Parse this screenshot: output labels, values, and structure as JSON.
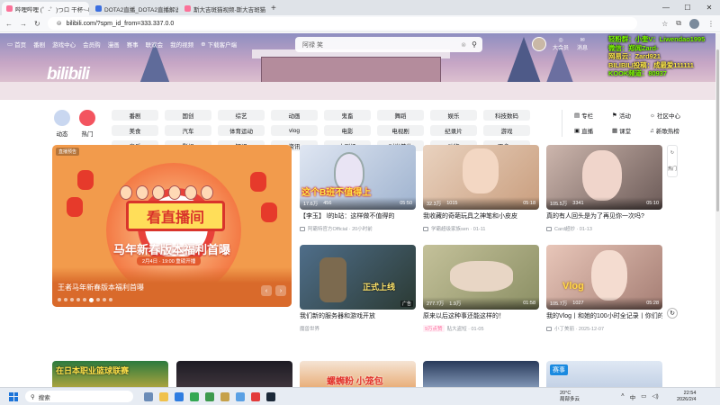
{
  "browser": {
    "tabs": [
      {
        "title": "哔哩哔哩 (゜-゜)つロ 干杯~-bi",
        "active": true
      },
      {
        "title": "DOTA2直播_DOTA2直播解说",
        "active": false
      },
      {
        "title": "斯大吉斑猫视频-斯大吉斑猫",
        "active": false
      }
    ],
    "new_tab": "+",
    "controls": {
      "min": "—",
      "max": "☐",
      "close": "✕"
    },
    "url": "bilibili.com/?spm_id_from=333.337.0.0"
  },
  "header": {
    "nav": [
      "首页",
      "番剧",
      "游戏中心",
      "会员购",
      "漫画",
      "赛事",
      "联欢会",
      "我的视频",
      "下载客户端"
    ],
    "logo": "bilibili",
    "search_placeholder": "阿禄 笑",
    "right_nav": [
      "大会员",
      "消息"
    ]
  },
  "overlay": {
    "line1": "轻粉群：小奎V：Liwendao1995",
    "line2": "微信：郑闻Zard-",
    "line3": "网易云：Zard921",
    "line4": "BILIBILI投稿：成最爱111111",
    "line5": "KOOK频道：80937"
  },
  "categories": {
    "dynamic": "动态",
    "hot": "热门",
    "chips": [
      "番剧",
      "国创",
      "综艺",
      "动画",
      "鬼畜",
      "舞蹈",
      "娱乐",
      "科技数码",
      "美食",
      "汽车",
      "体育运动",
      "vlog",
      "电影",
      "电视剧",
      "纪录片",
      "游戏",
      "音乐",
      "影视",
      "知识",
      "资讯",
      "小剧场",
      "时尚美妆",
      "动物",
      "更多 ⌄"
    ],
    "links": [
      "专栏",
      "活动",
      "社区中心",
      "直播",
      "课堂",
      "新歌热榜"
    ]
  },
  "hero": {
    "badge": "直播预告",
    "sign": "看直播间",
    "headline": "马年新春版本福利首曝",
    "date": "2月4日 · 19:00 重磅开播",
    "caption": "王者马年新春版本福利首曝"
  },
  "videos": [
    {
      "title": "【李玉】 l的b站：这样做不值得的",
      "thumb_text": "这个B班不值得上",
      "views": "17.6万",
      "danmaku": "456",
      "duration": "05:50",
      "owner": "阿霸特官方Official · 20小时前",
      "pill": ""
    },
    {
      "title": "我收藏的奇葩玩具之神笔和小皮皮",
      "thumb_text": "",
      "views": "32.3万",
      "danmaku": "1015",
      "duration": "05:18",
      "owner": "学霸超级家族sen · 01-11",
      "pill": ""
    },
    {
      "title": "真的有人回头是为了再见你一次吗?",
      "thumb_text": "",
      "views": "105.5万",
      "danmaku": "3341",
      "duration": "05:10",
      "owner": "Card超妙 · 01-13",
      "pill": ""
    },
    {
      "title": "我们新的服务器和游戏开放",
      "thumb_text": "正式上线",
      "views": "",
      "danmaku": "",
      "duration": "",
      "owner": "魔兽世界",
      "pill": "",
      "tag": "广告"
    },
    {
      "title": "原来以后这种事还能这样的！",
      "thumb_text": "",
      "views": "277.7万",
      "danmaku": "1.9万",
      "duration": "01:58",
      "owner": "贴大盗短 · 01-05",
      "pill": "9万点赞"
    },
    {
      "title": "我的Vlog丨和她的100小时全记录丨你们的关系",
      "thumb_text": "Vlog",
      "views": "105.7万",
      "danmaku": "1027",
      "duration": "05:28",
      "owner": "小丁美丽 · 2025-12-07",
      "pill": ""
    }
  ],
  "row3": [
    {
      "text": "在日本职业篮球联赛"
    },
    {
      "text": ""
    },
    {
      "text": "螺蛳粉 小笼包"
    },
    {
      "text": ""
    },
    {
      "text": "赛事"
    }
  ],
  "side": {
    "label": "热门"
  },
  "taskbar": {
    "search": "搜索",
    "weather_temp": "20°C",
    "weather_desc": "局部多云",
    "time": "22:54",
    "date": "2026/2/4",
    "lang": "中"
  }
}
